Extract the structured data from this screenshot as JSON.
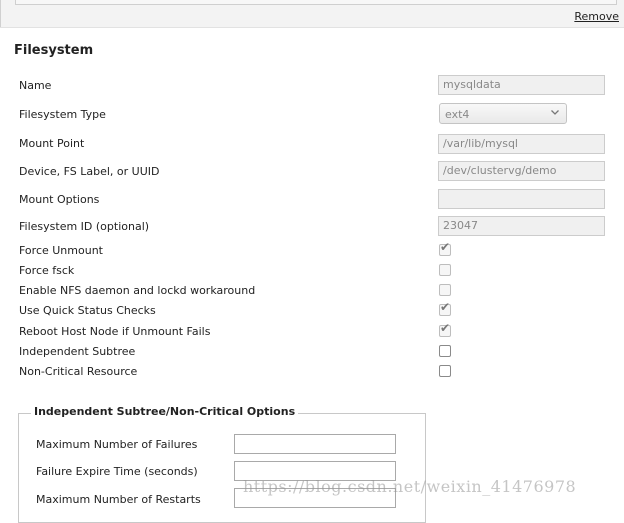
{
  "header": {
    "remove_label": "Remove"
  },
  "filesystem": {
    "title": "Filesystem",
    "name": {
      "label": "Name",
      "value": "mysqldata"
    },
    "type": {
      "label": "Filesystem Type",
      "value": "ext4"
    },
    "mount_point": {
      "label": "Mount Point",
      "value": "/var/lib/mysql"
    },
    "device": {
      "label": "Device, FS Label, or UUID",
      "value": "/dev/clustervg/demo"
    },
    "mount_options": {
      "label": "Mount Options",
      "value": ""
    },
    "fs_id": {
      "label": "Filesystem ID (optional)",
      "value": "23047"
    },
    "force_unmount": {
      "label": "Force Unmount",
      "checked": true
    },
    "force_fsck": {
      "label": "Force fsck",
      "checked": false
    },
    "nfs_workaround": {
      "label": "Enable NFS daemon and lockd workaround",
      "checked": false
    },
    "quick_status": {
      "label": "Use Quick Status Checks",
      "checked": true
    },
    "reboot_host": {
      "label": "Reboot Host Node if Unmount Fails",
      "checked": true
    },
    "independent_subtree": {
      "label": "Independent Subtree",
      "checked": false
    },
    "non_critical": {
      "label": "Non-Critical Resource",
      "checked": false
    }
  },
  "options": {
    "legend": "Independent Subtree/Non-Critical Options",
    "max_failures": {
      "label": "Maximum Number of Failures",
      "value": ""
    },
    "failure_expire": {
      "label": "Failure Expire Time (seconds)",
      "value": ""
    },
    "max_restarts": {
      "label": "Maximum Number of Restarts",
      "value": ""
    }
  },
  "watermark": "https://blog.csdn.net/weixin_41476978",
  "icons": {
    "select_chevron": "chevron-down-icon",
    "check": "checkmark-icon"
  },
  "colors": {
    "disabled_field_bg": "#f0f0f0",
    "disabled_text": "#888888",
    "border": "#cccccc"
  }
}
